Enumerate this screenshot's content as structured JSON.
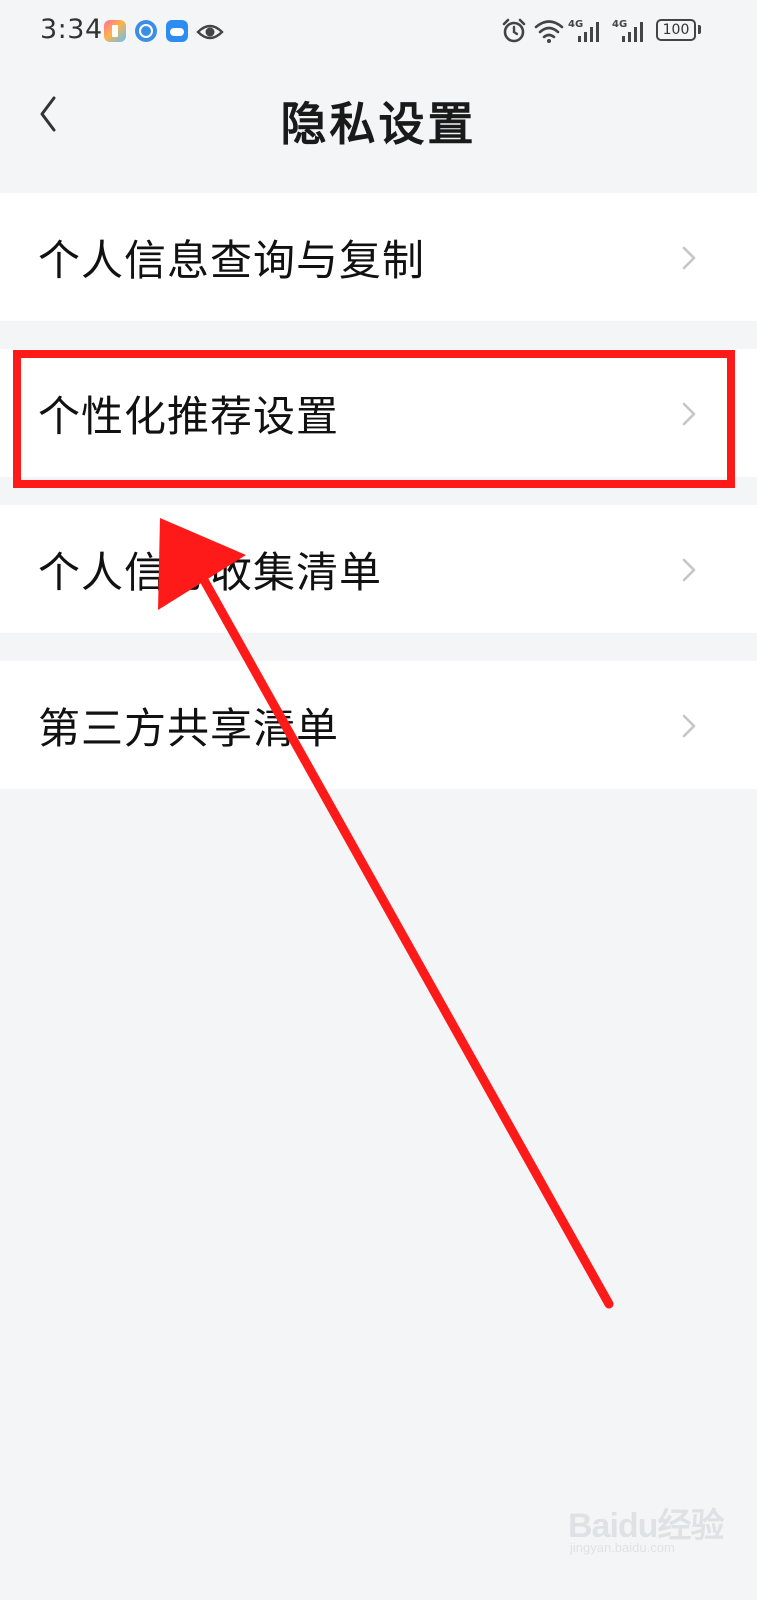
{
  "status_bar": {
    "time": "3:34",
    "battery": "100",
    "network_1": "4G",
    "network_2": "4G"
  },
  "nav": {
    "title": "隐私设置"
  },
  "list": {
    "items": [
      {
        "label": "个人信息查询与复制"
      },
      {
        "label": "个性化推荐设置"
      },
      {
        "label": "个人信息收集清单"
      },
      {
        "label": "第三方共享清单"
      }
    ]
  },
  "watermark": {
    "text": "Baidu经验",
    "sub": "jingyan.baidu.com"
  },
  "colors": {
    "background": "#f4f5f7",
    "row_background": "#ffffff",
    "annotation_red": "#ff1a1a",
    "chevron": "#c4c6ca"
  }
}
